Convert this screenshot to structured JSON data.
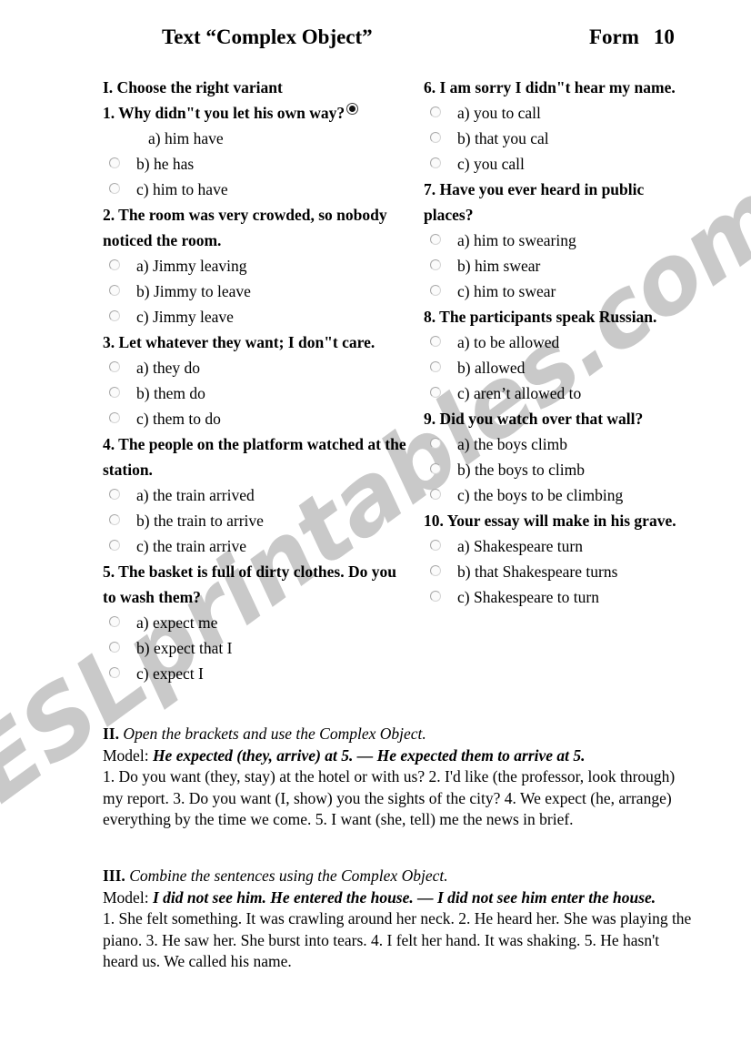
{
  "header": {
    "title": "Text “Complex Object”",
    "form_label": "Form",
    "form_number": "10"
  },
  "section_one": {
    "heading": "I. Choose the right variant",
    "questions": [
      {
        "text": "1. Why didn\"t you let ____ his own way?",
        "has_inline_selected_radio": true,
        "options": [
          {
            "label": "a) him have",
            "radio": "none",
            "checked": false
          },
          {
            "label": "b) he has",
            "radio": "circle",
            "checked": false
          },
          {
            "label": "c) him to have",
            "radio": "circle",
            "checked": false
          }
        ]
      },
      {
        "text": "2. The room was very crowded, so nobody noticed ___ the room.",
        "has_inline_selected_radio": false,
        "options": [
          {
            "label": "a) Jimmy leaving",
            "radio": "circle",
            "checked": false
          },
          {
            "label": "b) Jimmy to leave",
            "radio": "circle",
            "checked": false
          },
          {
            "label": "c) Jimmy leave",
            "radio": "circle",
            "checked": false
          }
        ]
      },
      {
        "text": "3. Let ___ whatever they want; I don\"t care.",
        "has_inline_selected_radio": false,
        "options": [
          {
            "label": "a) they do",
            "radio": "circle",
            "checked": false
          },
          {
            "label": "b) them do",
            "radio": "circle",
            "checked": false
          },
          {
            "label": "c) them to do",
            "radio": "circle",
            "checked": false
          }
        ]
      },
      {
        "text": "4. The people on the platform watched ___ at the station.",
        "has_inline_selected_radio": false,
        "options": [
          {
            "label": "a) the train arrived",
            "radio": "circle",
            "checked": false
          },
          {
            "label": "b) the train to arrive",
            "radio": "circle",
            "checked": false
          },
          {
            "label": "c) the train arrive",
            "radio": "circle",
            "checked": false
          }
        ]
      },
      {
        "text": "5. The basket is full of dirty clothes. Do you ___ to wash them?",
        "has_inline_selected_radio": false,
        "options": [
          {
            "label": "a) expect me",
            "radio": "circle",
            "checked": false
          },
          {
            "label": "b) expect that I",
            "radio": "circle",
            "checked": false
          },
          {
            "label": "c) expect I",
            "radio": "circle",
            "checked": false
          }
        ]
      },
      {
        "text": "6. I am sorry I didn\"t hear ___ my name.",
        "has_inline_selected_radio": false,
        "options": [
          {
            "label": "a) you to call",
            "radio": "circle",
            "checked": false
          },
          {
            "label": "b) that you cal",
            "radio": "circle",
            "checked": false
          },
          {
            "label": "c) you call",
            "radio": "circle",
            "checked": false
          }
        ]
      },
      {
        "text": "7. Have you ever heard ___ in public places?",
        "has_inline_selected_radio": false,
        "options": [
          {
            "label": "a) him to swearing",
            "radio": "circle",
            "checked": false
          },
          {
            "label": "b) him swear",
            "radio": "circle",
            "checked": false
          },
          {
            "label": "c) him to swear",
            "radio": "circle",
            "checked": false
          }
        ]
      },
      {
        "text": "8. The participants ____ speak Russian.",
        "has_inline_selected_radio": false,
        "options": [
          {
            "label": "a) to be allowed",
            "radio": "circle",
            "checked": false
          },
          {
            "label": "b) allowed",
            "radio": "circle",
            "checked": false
          },
          {
            "label": "c) aren’t allowed to",
            "radio": "circle",
            "checked": false
          }
        ]
      },
      {
        "text": "9. Did you watch ___ over that wall?",
        "has_inline_selected_radio": false,
        "options": [
          {
            "label": "a) the boys climb",
            "radio": "circle",
            "checked": false
          },
          {
            "label": "b) the boys to climb",
            "radio": "circle",
            "checked": false
          },
          {
            "label": "c) the boys to be climbing",
            "radio": "circle",
            "checked": false
          }
        ]
      },
      {
        "text": "10. Your essay will make ___ in his grave.",
        "has_inline_selected_radio": false,
        "options": [
          {
            "label": "a) Shakespeare turn",
            "radio": "circle",
            "checked": false
          },
          {
            "label": "b) that Shakespeare turns",
            "radio": "circle",
            "checked": false
          },
          {
            "label": "c) Shakespeare to turn",
            "radio": "circle",
            "checked": false
          }
        ]
      }
    ]
  },
  "section_two": {
    "numeral": "II.",
    "instruction": "Open the brackets and use the Complex Object.",
    "model_word": "Model:",
    "model_text": "He expected (they, arrive) at 5. — He expected them to arrive at 5.",
    "body": "1. Do you want (they, stay) at the hotel or with us? 2. I'd like (the professor, look through) my report. 3. Do you want (I, show) you the sights of the city? 4. We expect (he, arrange) everything by the time we come. 5. I want (she, tell) me the news in brief."
  },
  "section_three": {
    "numeral": "III.",
    "instruction": "Combine the sentences using the Complex Object.",
    "model_word": "Model:",
    "model_text": "I did not see him. He entered the house. — I did not see him enter the house.",
    "body": "1. She felt something. It was crawling around her neck.  2. He heard her. She was playing the piano. 3. He saw her. She burst into tears. 4. I felt her hand. It was shaking. 5. He hasn't heard us. We called his name."
  },
  "watermark": {
    "text": "ESLprintables.com",
    "color": "#c9c9c9"
  }
}
